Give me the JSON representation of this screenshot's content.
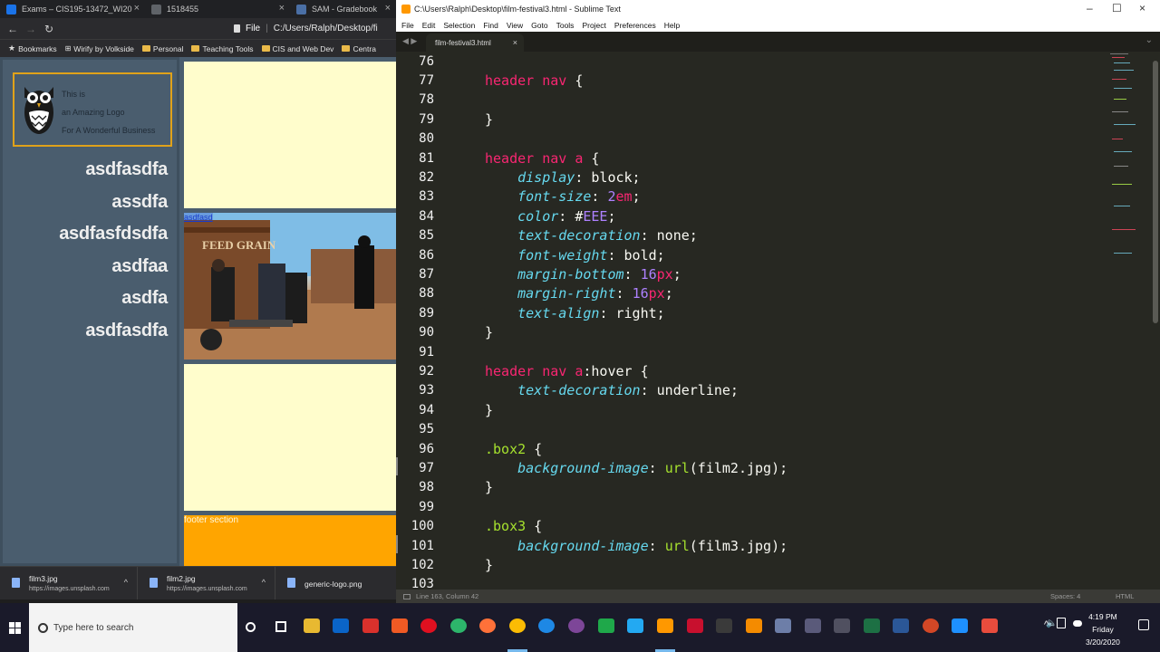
{
  "browser": {
    "tabs": [
      {
        "label": "Exams – CIS195-13472_WI20",
        "color": "#1a73e8"
      },
      {
        "label": "1518455",
        "color": "#5f6368"
      },
      {
        "label": "SAM - Gradebook",
        "color": "#4a6fa5"
      }
    ],
    "address_label": "File",
    "address_text": "C:/Users/Ralph/Desktop/fi",
    "bookmarks": [
      {
        "label": "Bookmarks",
        "icon": "star"
      },
      {
        "label": "Wirify by Volkside",
        "icon": "bookmarklet"
      },
      {
        "label": "Personal",
        "icon": "folder"
      },
      {
        "label": "Teaching Tools",
        "icon": "folder"
      },
      {
        "label": "CIS and Web Dev",
        "icon": "folder"
      },
      {
        "label": "Centra",
        "icon": "folder"
      }
    ],
    "page": {
      "logo_lines": [
        "This is",
        "an Amazing Logo",
        "For A Wonderful Business"
      ],
      "nav_links": [
        "asdfasdfa",
        "assdfa",
        "asdfasfdsdfa",
        "asdfaa",
        "asdfa",
        "asdfasdfa"
      ],
      "photo_caption": "asdfasd",
      "photo_sign": "FEED GRAIN",
      "footer_text": "footer section"
    },
    "downloads": [
      {
        "name": "film3.jpg",
        "url": "https://images.unsplash.com"
      },
      {
        "name": "film2.jpg",
        "url": "https://images.unsplash.com"
      },
      {
        "name": "generic-logo.png",
        "url": ""
      }
    ]
  },
  "sublime": {
    "title": "C:\\Users\\Ralph\\Desktop\\film-festival3.html - Sublime Text",
    "menu": [
      "File",
      "Edit",
      "Selection",
      "Find",
      "View",
      "Goto",
      "Tools",
      "Project",
      "Preferences",
      "Help"
    ],
    "tab": "film-festival3.html",
    "status_left": "Line 163, Column 42",
    "status_spaces": "Spaces: 4",
    "status_syntax": "HTML",
    "line_numbers": [
      "76",
      "77",
      "78",
      "79",
      "80",
      "81",
      "82",
      "83",
      "84",
      "85",
      "86",
      "87",
      "88",
      "89",
      "90",
      "91",
      "92",
      "93",
      "94",
      "95",
      "96",
      "97",
      "98",
      "99",
      "100",
      "101",
      "102",
      "103"
    ]
  },
  "taskbar": {
    "search_placeholder": "Type here to search",
    "time": "4:19 PM",
    "day": "Friday",
    "date": "3/20/2020"
  }
}
